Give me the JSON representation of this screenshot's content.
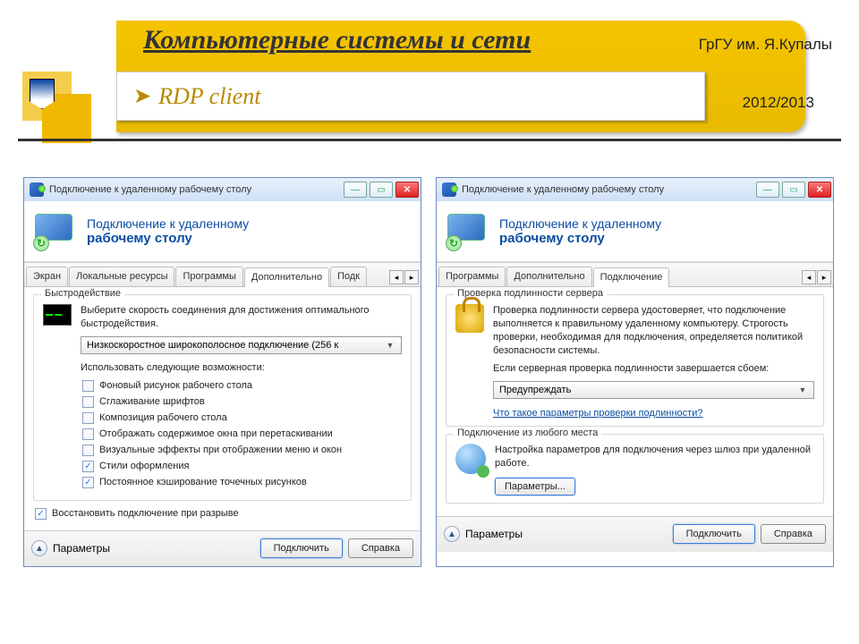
{
  "header": {
    "main_title": "Компьютерные системы и сети",
    "university": "ГрГУ им. Я.Купалы",
    "year": "2012/2013",
    "subtitle": "RDP client"
  },
  "common": {
    "window_title": "Подключение к удаленному рабочему столу",
    "banner_line1": "Подключение к удаленному",
    "banner_line2": "рабочему столу",
    "options_label": "Параметры",
    "connect_label": "Подключить",
    "help_label": "Справка"
  },
  "left": {
    "tabs": [
      "Экран",
      "Локальные ресурсы",
      "Программы",
      "Дополнительно",
      "Подк"
    ],
    "active_tab": 3,
    "perf": {
      "group_title": "Быстродействие",
      "desc": "Выберите скорость соединения для достижения оптимального быстродействия.",
      "combo": "Низкоскоростное широкополосное подключение (256 к",
      "use_label": "Использовать следующие возможности:",
      "checks": [
        {
          "label": "Фоновый рисунок рабочего стола",
          "checked": false
        },
        {
          "label": "Сглаживание шрифтов",
          "checked": false
        },
        {
          "label": "Композиция рабочего стола",
          "checked": false
        },
        {
          "label": "Отображать содержимое окна при перетаскивании",
          "checked": false
        },
        {
          "label": "Визуальные эффекты при отображении меню и окон",
          "checked": false
        },
        {
          "label": "Стили оформления",
          "checked": true
        },
        {
          "label": "Постоянное кэширование точечных рисунков",
          "checked": true
        }
      ]
    },
    "reconnect": {
      "label": "Восстановить подключение при разрыве",
      "checked": true
    }
  },
  "right": {
    "tabs": [
      "Программы",
      "Дополнительно",
      "Подключение"
    ],
    "active_tab": 2,
    "auth": {
      "group_title": "Проверка подлинности сервера",
      "desc": "Проверка подлинности сервера удостоверяет, что подключение выполняется к правильному удаленному компьютеру. Строгость проверки, необходимая для подключения, определяется политикой безопасности системы.",
      "fail_label": "Если серверная проверка подлинности завершается сбоем:",
      "combo": "Предупреждать",
      "link": "Что такое параметры проверки подлинности?"
    },
    "gateway": {
      "group_title": "Подключение из любого места",
      "desc": "Настройка параметров для подключения через шлюз при удаленной работе.",
      "button": "Параметры..."
    }
  }
}
